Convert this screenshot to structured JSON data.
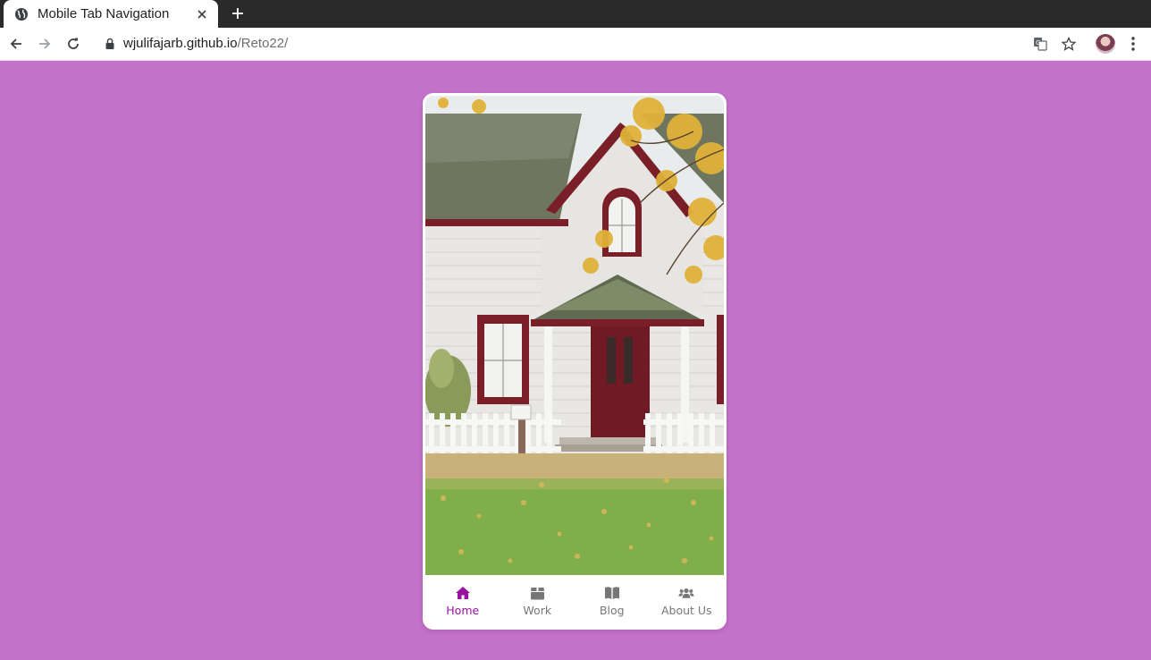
{
  "browser": {
    "tab_title": "Mobile Tab Navigation",
    "url_host": "wjulifajarb.github.io",
    "url_path": "/Reto22/"
  },
  "colors": {
    "page_background": "#c471c9",
    "active": "#9a139f",
    "inactive": "#777777"
  },
  "app": {
    "photo": "house-photo",
    "nav": [
      {
        "label": "Home",
        "icon": "home-icon",
        "active": true
      },
      {
        "label": "Work",
        "icon": "box-icon",
        "active": false
      },
      {
        "label": "Blog",
        "icon": "book-icon",
        "active": false
      },
      {
        "label": "About Us",
        "icon": "users-icon",
        "active": false
      }
    ]
  }
}
